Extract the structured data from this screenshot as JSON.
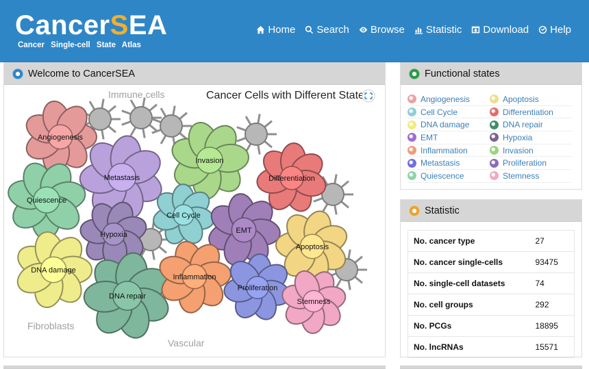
{
  "header": {
    "logo_text_main": "Cancer",
    "logo_text_s": "S",
    "logo_text_ea": "EA",
    "subtitle": "Cancer Single-cell State Atlas",
    "nav": [
      {
        "label": "Home",
        "icon": "home-icon"
      },
      {
        "label": "Search",
        "icon": "search-icon"
      },
      {
        "label": "Browse",
        "icon": "eye-icon"
      },
      {
        "label": "Statistic",
        "icon": "bar-chart-icon"
      },
      {
        "label": "Download",
        "icon": "download-icon"
      },
      {
        "label": "Help",
        "icon": "help-icon"
      }
    ]
  },
  "welcome": {
    "title": "Welcome to CancerSEA",
    "figure": {
      "heading": "Cancer Cells with Different States",
      "immune_label": "Immune cells",
      "fibroblasts_label": "Fibroblasts",
      "vascular_label": "Vascular",
      "cells": [
        {
          "label": "Angiogenesis",
          "color": "#e59a9a"
        },
        {
          "label": "Metastasis",
          "color": "#b9a2dc"
        },
        {
          "label": "Invasion",
          "color": "#a9d88a"
        },
        {
          "label": "Differentiation",
          "color": "#e97a7a"
        },
        {
          "label": "Quiescence",
          "color": "#8fd0a8"
        },
        {
          "label": "Cell Cycle",
          "color": "#8fd0d2"
        },
        {
          "label": "Hypoxia",
          "color": "#9a88b8"
        },
        {
          "label": "EMT",
          "color": "#a07fb8"
        },
        {
          "label": "Apoptosis",
          "color": "#f2d684"
        },
        {
          "label": "DNA damage",
          "color": "#efec8c"
        },
        {
          "label": "DNA repair",
          "color": "#7fb79c"
        },
        {
          "label": "Inflammation",
          "color": "#f4a071"
        },
        {
          "label": "Proliferation",
          "color": "#8c96e0"
        },
        {
          "label": "Stemness",
          "color": "#f2a8c4"
        }
      ]
    }
  },
  "functional_states": {
    "title": "Functional states",
    "items": [
      {
        "label": "Angiogenesis",
        "color": "#e9a3a3"
      },
      {
        "label": "Apoptosis",
        "color": "#f0dc8c"
      },
      {
        "label": "Cell Cycle",
        "color": "#8fcfd4"
      },
      {
        "label": "Differentiation",
        "color": "#e46b6b"
      },
      {
        "label": "DNA damage",
        "color": "#f1ec7b"
      },
      {
        "label": "DNA repair",
        "color": "#3f8f6a"
      },
      {
        "label": "EMT",
        "color": "#9b6fd1"
      },
      {
        "label": "Hypoxia",
        "color": "#7a6293"
      },
      {
        "label": "Inflammation",
        "color": "#f09b7a"
      },
      {
        "label": "Invasion",
        "color": "#9bd47e"
      },
      {
        "label": "Metastasis",
        "color": "#6f6fe0"
      },
      {
        "label": "Proliferation",
        "color": "#8c6ab8"
      },
      {
        "label": "Quiescence",
        "color": "#8ed4a8"
      },
      {
        "label": "Stemness",
        "color": "#f1a9c3"
      }
    ]
  },
  "statistic": {
    "title": "Statistic",
    "rows": [
      {
        "label": "No. cancer type",
        "value": "27"
      },
      {
        "label": "No. cancer single-cells",
        "value": "93475"
      },
      {
        "label": "No. single-cell datasets",
        "value": "74"
      },
      {
        "label": "No. cell groups",
        "value": "292"
      },
      {
        "label": "No. PCGs",
        "value": "18895"
      },
      {
        "label": "No. lncRNAs",
        "value": "15571"
      }
    ]
  },
  "colors": {
    "header_bg": "#2f86c6",
    "panel_head_bg": "#d6d6d6",
    "link_color": "#3b7fb8"
  }
}
